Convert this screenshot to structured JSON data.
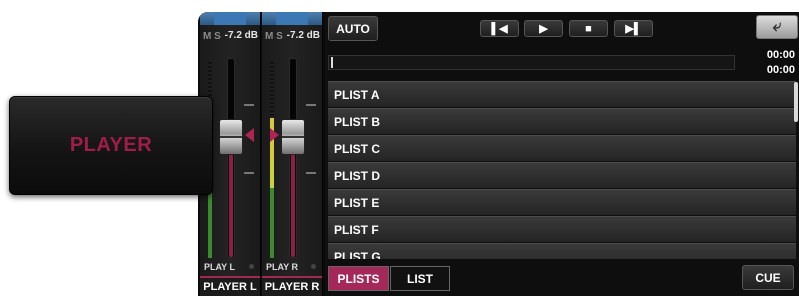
{
  "player_tab": {
    "label": "PLAYER"
  },
  "strips": [
    {
      "ms": "M S",
      "db": "-7.2 dB",
      "play_label": "PLAY L",
      "name": "PLAYER L"
    },
    {
      "ms": "M S",
      "db": "-7.2 dB",
      "play_label": "PLAY R",
      "name": "PLAYER R"
    }
  ],
  "toolbar": {
    "auto_label": "AUTO",
    "prev_icon": "skip-back-icon",
    "play_icon": "play-icon",
    "stop_icon": "stop-icon",
    "next_icon": "skip-forward-icon",
    "back_icon": "back-arrow-icon"
  },
  "times": {
    "elapsed": "00:00",
    "remaining": "00:00"
  },
  "playlists": [
    "PLIST A",
    "PLIST B",
    "PLIST C",
    "PLIST D",
    "PLIST E",
    "PLIST F",
    "PLIST G"
  ],
  "tabs": {
    "plists": "PLISTS",
    "list": "LIST"
  },
  "cue_label": "CUE",
  "colors": {
    "accent": "#a5285a",
    "bg": "#0e0e0e",
    "row": "#2e2e2e"
  }
}
